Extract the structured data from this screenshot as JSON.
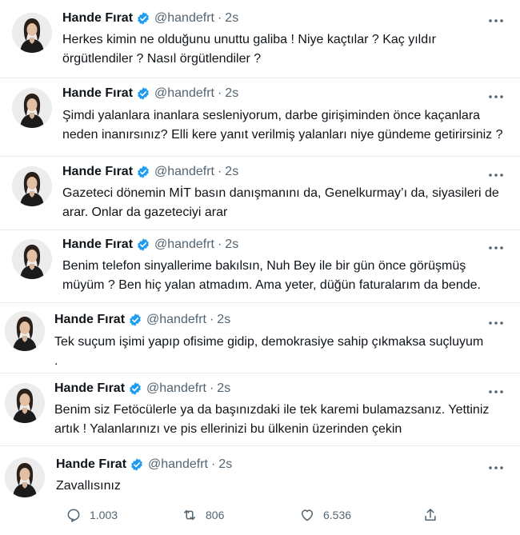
{
  "author": {
    "name": "Hande Fırat",
    "handle": "@handefrt"
  },
  "separator": "·",
  "tweets": [
    {
      "time": "2s",
      "text": "Herkes kimin ne olduğunu unuttu galiba !  Niye kaçtılar ? Kaç yıldır\nörgütlendiler ? Nasıl örgütlendiler ?"
    },
    {
      "time": "2s",
      "text": "Şimdi yalanlara inanlara sesleniyorum, darbe girişiminden önce kaçanlara\nneden inanırsınız? Elli kere yanıt verilmiş yalanları niye gündeme getirirsiniz ?"
    },
    {
      "time": "2s",
      "text": "Gazeteci dönemin MİT basın danışmanını da, Genelkurmay’ı da, siyasileri de\narar. Onlar da gazeteciyi arar"
    },
    {
      "time": "2s",
      "text": "Benim telefon sinyallerime bakılsın, Nuh Bey ile bir gün önce görüşmüş\nmüyüm ? Ben hiç yalan atmadım. Ama yeter, düğün faturalarım da bende."
    },
    {
      "time": "2s",
      "text": "Tek suçum işimi yapıp ofisime gidip, demokrasiye sahip çıkmaksa suçluyum\n."
    },
    {
      "time": "2s",
      "text": "Benim siz Fetöcülerle ya da başınızdaki ile tek karemi bulamazsanız. Yettiniz\nartık ! Yalanlarınızı ve pis ellerinizi bu ülkenin üzerinden çekin"
    },
    {
      "time": "2s",
      "text": "Zavallısınız"
    }
  ],
  "actions": {
    "replies": "1.003",
    "retweets": "806",
    "likes": "6.536"
  },
  "colors": {
    "verified": "#1d9bf0",
    "secondary": "#536471",
    "text": "#0f1419"
  }
}
